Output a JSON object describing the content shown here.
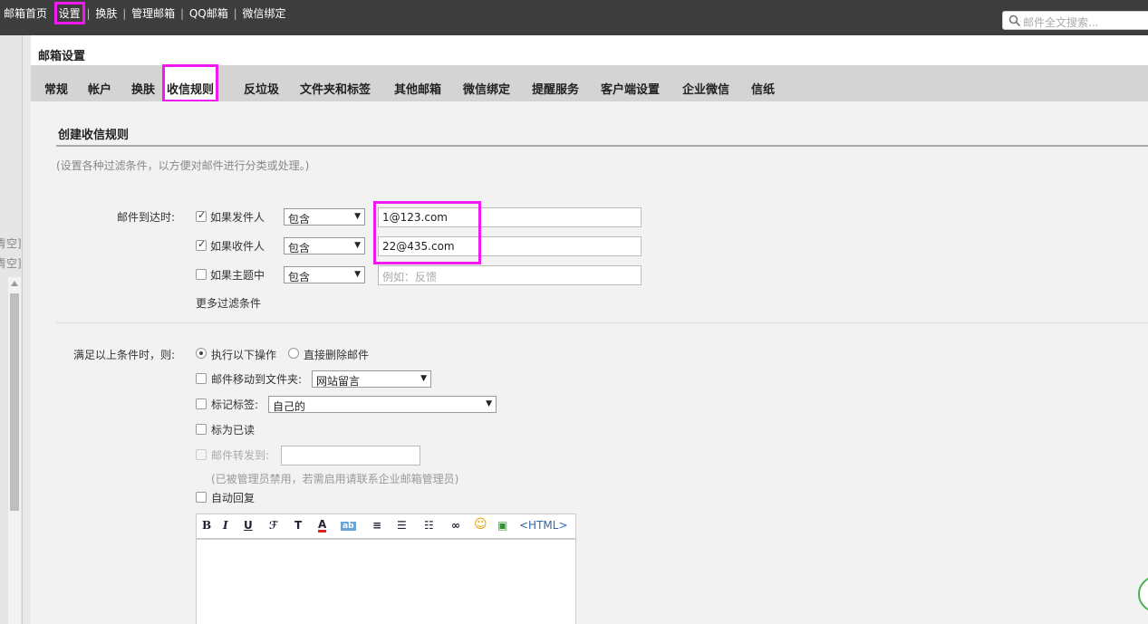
{
  "topnav": {
    "items": [
      "邮箱首页",
      "设置",
      "换肤",
      "管理邮箱",
      "QQ邮箱",
      "微信绑定"
    ],
    "separator": "|",
    "search_placeholder": "邮件全文搜索..."
  },
  "leftrail": {
    "fragments": [
      "青空]",
      "青空]"
    ]
  },
  "panel": {
    "title": "邮箱设置",
    "tabs": [
      "常规",
      "帐户",
      "换肤",
      "收信规则",
      "反垃圾",
      "文件夹和标签",
      "其他邮箱",
      "微信绑定",
      "提醒服务",
      "客户端设置",
      "企业微信",
      "信纸"
    ],
    "active_tab": "收信规则"
  },
  "rule": {
    "section_title": "创建收信规则",
    "hint": "(设置各种过滤条件，以方便对邮件进行分类或处理。)",
    "arrival_label": "邮件到达时:",
    "conditions": [
      {
        "label": "如果发件人",
        "checked": true,
        "operator": "包含",
        "value": "1@123.com",
        "placeholder": ""
      },
      {
        "label": "如果收件人",
        "checked": true,
        "operator": "包含",
        "value": "22@435.com",
        "placeholder": ""
      },
      {
        "label": "如果主题中",
        "checked": false,
        "operator": "包含",
        "value": "",
        "placeholder": "例如：反馈"
      }
    ],
    "more_conditions": "更多过滤条件",
    "then_label": "满足以上条件时，则:",
    "radio_execute": "执行以下操作",
    "radio_delete": "直接删除邮件",
    "move_label": "邮件移动到文件夹:",
    "move_folder": "网站留言",
    "tag_label": "标记标签:",
    "tag_value": "自己的",
    "mark_read_label": "标为已读",
    "forward_label": "邮件转发到:",
    "forward_note": "(已被管理员禁用，若需启用请联系企业邮箱管理员)",
    "auto_reply_label": "自动回复",
    "html_label": "<HTML>"
  }
}
